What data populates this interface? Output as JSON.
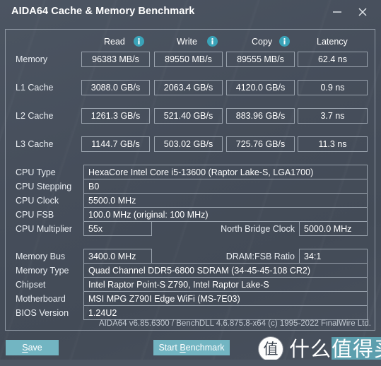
{
  "window": {
    "title": "AIDA64 Cache & Memory Benchmark",
    "minimize_icon": "minimize-icon",
    "close_icon": "close-icon"
  },
  "benchmark": {
    "columns": [
      {
        "label": "Read",
        "info_icon": "info-icon"
      },
      {
        "label": "Write",
        "info_icon": "info-icon"
      },
      {
        "label": "Copy",
        "info_icon": "info-icon"
      },
      {
        "label": "Latency",
        "info_icon": null
      }
    ],
    "rows": [
      {
        "label": "Memory",
        "read": "96383 MB/s",
        "write": "89550 MB/s",
        "copy": "89555 MB/s",
        "latency": "62.4 ns"
      },
      {
        "label": "L1 Cache",
        "read": "3088.0 GB/s",
        "write": "2063.4 GB/s",
        "copy": "4120.0 GB/s",
        "latency": "0.9 ns"
      },
      {
        "label": "L2 Cache",
        "read": "1261.3 GB/s",
        "write": "521.40 GB/s",
        "copy": "883.96 GB/s",
        "latency": "3.7 ns"
      },
      {
        "label": "L3 Cache",
        "read": "1144.7 GB/s",
        "write": "503.02 GB/s",
        "copy": "725.76 GB/s",
        "latency": "11.3 ns"
      }
    ]
  },
  "cpu_info": {
    "cpu_type_label": "CPU Type",
    "cpu_type_value": "HexaCore Intel Core i5-13600  (Raptor Lake-S, LGA1700)",
    "cpu_stepping_label": "CPU Stepping",
    "cpu_stepping_value": "B0",
    "cpu_clock_label": "CPU Clock",
    "cpu_clock_value": "5500.0 MHz",
    "cpu_fsb_label": "CPU FSB",
    "cpu_fsb_value": "100.0 MHz  (original: 100 MHz)",
    "cpu_multiplier_label": "CPU Multiplier",
    "cpu_multiplier_value": "55x",
    "north_bridge_clock_label": "North Bridge Clock",
    "north_bridge_clock_value": "5000.0 MHz"
  },
  "memory_info": {
    "memory_bus_label": "Memory Bus",
    "memory_bus_value": "3400.0 MHz",
    "dram_fsb_ratio_label": "DRAM:FSB Ratio",
    "dram_fsb_ratio_value": "34:1",
    "memory_type_label": "Memory Type",
    "memory_type_value": "Quad Channel DDR5-6800 SDRAM  (34-45-45-108 CR2)",
    "chipset_label": "Chipset",
    "chipset_value": "Intel Raptor Point-S Z790, Intel Raptor Lake-S",
    "motherboard_label": "Motherboard",
    "motherboard_value": "MSI MPG Z790I Edge WiFi (MS-7E03)",
    "bios_version_label": "BIOS Version",
    "bios_version_value": "1.24U2"
  },
  "footer": {
    "version_note": "AIDA64 v6.85.6300 / BenchDLL 4.6.875.8-x64  (c) 1995-2022 FinalWire Ltd.",
    "save_label_pre": "",
    "save_accel": "S",
    "save_label_post": "ave",
    "benchmark_label_pre": "Start ",
    "benchmark_accel": "B",
    "benchmark_label_post": "enchmark"
  },
  "watermark": {
    "badge": "值",
    "text_plain": "什么",
    "text_highlight": "值得买"
  },
  "colors": {
    "accent": "#72b5c2",
    "info_icon": "#3aa3b8",
    "background": "#464e5b",
    "border": "#9aa3ae",
    "watermark_highlight": "#5d9fae"
  }
}
